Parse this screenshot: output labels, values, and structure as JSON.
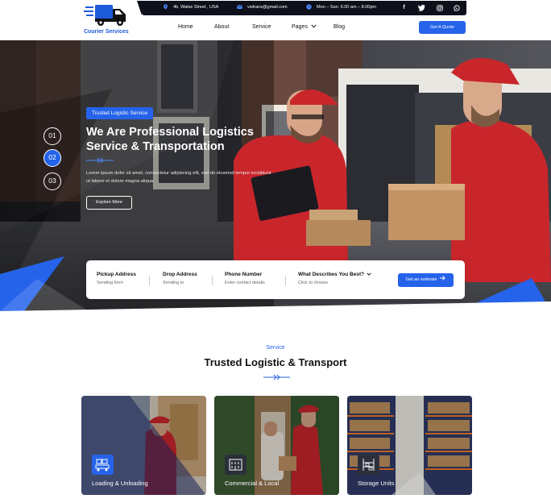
{
  "brand": {
    "name": "Courier Services",
    "accent": "#2563eb",
    "dark": "#0d0f1a"
  },
  "topbar": {
    "address": "4b, Walse Street , USA",
    "email": "vwtrans@gmail.com",
    "hours": "Mon – Sun: 9.00 am – 8.00pm",
    "address_icon": "map-pin-icon",
    "email_icon": "envelope-icon",
    "hours_icon": "clock-icon",
    "social": [
      "facebook-icon",
      "twitter-icon",
      "instagram-icon",
      "whatsapp-icon"
    ]
  },
  "nav": {
    "items": [
      "Home",
      "About",
      "Service",
      "Pages",
      "Blog"
    ],
    "cta": "Get A Quote"
  },
  "hero": {
    "badge": "Trusted Logistic Service",
    "title": "We Are Professional Logistics Service & Transportation",
    "description": "Lorem ipsum dolor sit amet, consectetur adipiscing elit, sed do eiusmod tempor incididunt ut labore et dolore magna aliqua.",
    "button": "Explore More",
    "slides": [
      "01",
      "02",
      "03"
    ],
    "active_slide": 1
  },
  "estimate": {
    "fields": [
      {
        "label": "Pickup Address",
        "placeholder": "Sending form"
      },
      {
        "label": "Drop Address",
        "placeholder": "Sending to"
      },
      {
        "label": "Phone Number",
        "placeholder": "Enter contact details"
      },
      {
        "label": "What Describes You Best?",
        "placeholder": "Click to choses"
      }
    ],
    "button": "Get an estimate"
  },
  "services": {
    "tag": "Service",
    "title": "Trusted Logistic & Transport",
    "cards": [
      {
        "label": "Loading & Unloading",
        "icon": "forklift-icon"
      },
      {
        "label": "Commercial & Local",
        "icon": "building-icon"
      },
      {
        "label": "Storage Units",
        "icon": "warehouse-shelf-icon"
      }
    ]
  }
}
